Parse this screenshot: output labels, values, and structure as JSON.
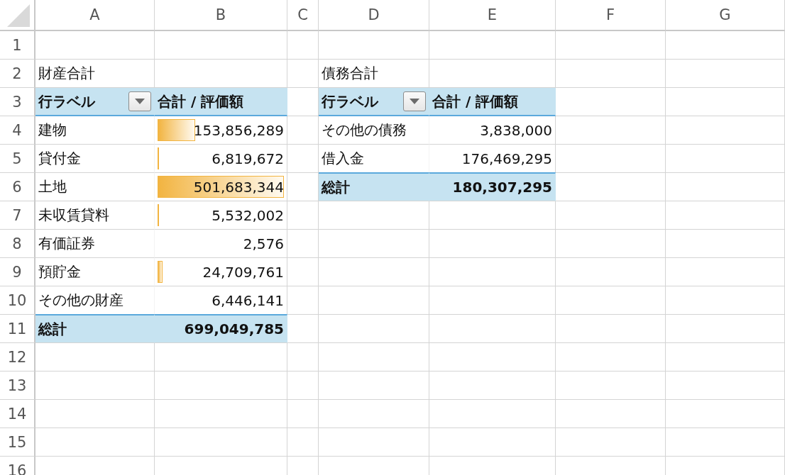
{
  "columns": [
    "A",
    "B",
    "C",
    "D",
    "E",
    "F",
    "G"
  ],
  "rows": [
    {
      "number": "1",
      "cells": [
        {
          "kind": "blank"
        },
        {
          "kind": "blank"
        },
        {
          "kind": "blank"
        },
        {
          "kind": "blank"
        },
        {
          "kind": "blank"
        },
        {
          "kind": "blank"
        },
        {
          "kind": "blank"
        }
      ]
    },
    {
      "number": "2",
      "cells": [
        {
          "kind": "label",
          "text": "財産合計"
        },
        {
          "kind": "blank"
        },
        {
          "kind": "blank"
        },
        {
          "kind": "label",
          "text": "債務合計"
        },
        {
          "kind": "blank"
        },
        {
          "kind": "blank"
        },
        {
          "kind": "blank"
        }
      ]
    },
    {
      "number": "3",
      "cells": [
        {
          "kind": "header-label",
          "text": "行ラベル"
        },
        {
          "kind": "header-value",
          "text": "合計 / 評価額"
        },
        {
          "kind": "blank"
        },
        {
          "kind": "header-label",
          "text": "行ラベル"
        },
        {
          "kind": "header-value",
          "text": "合計 / 評価額"
        },
        {
          "kind": "blank"
        },
        {
          "kind": "blank"
        }
      ]
    },
    {
      "number": "4",
      "cells": [
        {
          "kind": "item",
          "text": "建物"
        },
        {
          "kind": "value",
          "text": "153,856,289",
          "level": 0.3
        },
        {
          "kind": "blank"
        },
        {
          "kind": "item",
          "text": "その他の債務"
        },
        {
          "kind": "value",
          "text": "3,838,000"
        },
        {
          "kind": "blank"
        },
        {
          "kind": "blank"
        }
      ]
    },
    {
      "number": "5",
      "cells": [
        {
          "kind": "item",
          "text": "貸付金"
        },
        {
          "kind": "value",
          "text": "6,819,672",
          "level": 0.006
        },
        {
          "kind": "blank"
        },
        {
          "kind": "item",
          "text": "借入金"
        },
        {
          "kind": "value",
          "text": "176,469,295"
        },
        {
          "kind": "blank"
        },
        {
          "kind": "blank"
        }
      ]
    },
    {
      "number": "6",
      "cells": [
        {
          "kind": "item",
          "text": "土地"
        },
        {
          "kind": "value",
          "text": "501,683,344",
          "level": 1
        },
        {
          "kind": "blank"
        },
        {
          "kind": "total-label",
          "text": "総計"
        },
        {
          "kind": "total-value",
          "text": "180,307,295"
        },
        {
          "kind": "blank"
        },
        {
          "kind": "blank"
        }
      ]
    },
    {
      "number": "7",
      "cells": [
        {
          "kind": "item",
          "text": "未収賃貸料"
        },
        {
          "kind": "value",
          "text": "5,532,002",
          "level": 0.006
        },
        {
          "kind": "blank"
        },
        {
          "kind": "blank"
        },
        {
          "kind": "blank"
        },
        {
          "kind": "blank"
        },
        {
          "kind": "blank"
        }
      ]
    },
    {
      "number": "8",
      "cells": [
        {
          "kind": "item",
          "text": "有価証券"
        },
        {
          "kind": "value",
          "text": "2,576"
        },
        {
          "kind": "blank"
        },
        {
          "kind": "blank"
        },
        {
          "kind": "blank"
        },
        {
          "kind": "blank"
        },
        {
          "kind": "blank"
        }
      ]
    },
    {
      "number": "9",
      "cells": [
        {
          "kind": "item",
          "text": "預貯金"
        },
        {
          "kind": "value",
          "text": "24,709,761",
          "level": 0.04
        },
        {
          "kind": "blank"
        },
        {
          "kind": "blank"
        },
        {
          "kind": "blank"
        },
        {
          "kind": "blank"
        },
        {
          "kind": "blank"
        }
      ]
    },
    {
      "number": "10",
      "cells": [
        {
          "kind": "item",
          "text": "その他の財産"
        },
        {
          "kind": "value",
          "text": "6,446,141"
        },
        {
          "kind": "blank"
        },
        {
          "kind": "blank"
        },
        {
          "kind": "blank"
        },
        {
          "kind": "blank"
        },
        {
          "kind": "blank"
        }
      ]
    },
    {
      "number": "11",
      "cells": [
        {
          "kind": "total-label",
          "text": "総計"
        },
        {
          "kind": "total-value",
          "text": "699,049,785"
        },
        {
          "kind": "blank"
        },
        {
          "kind": "blank"
        },
        {
          "kind": "blank"
        },
        {
          "kind": "blank"
        },
        {
          "kind": "blank"
        }
      ]
    },
    {
      "number": "12",
      "cells": [
        {
          "kind": "blank"
        },
        {
          "kind": "blank"
        },
        {
          "kind": "blank"
        },
        {
          "kind": "blank"
        },
        {
          "kind": "blank"
        },
        {
          "kind": "blank"
        },
        {
          "kind": "blank"
        }
      ]
    },
    {
      "number": "13",
      "cells": [
        {
          "kind": "blank"
        },
        {
          "kind": "blank"
        },
        {
          "kind": "blank"
        },
        {
          "kind": "blank"
        },
        {
          "kind": "blank"
        },
        {
          "kind": "blank"
        },
        {
          "kind": "blank"
        }
      ]
    },
    {
      "number": "14",
      "cells": [
        {
          "kind": "blank"
        },
        {
          "kind": "blank"
        },
        {
          "kind": "blank"
        },
        {
          "kind": "blank"
        },
        {
          "kind": "blank"
        },
        {
          "kind": "blank"
        },
        {
          "kind": "blank"
        }
      ]
    },
    {
      "number": "15",
      "cells": [
        {
          "kind": "blank"
        },
        {
          "kind": "blank"
        },
        {
          "kind": "blank"
        },
        {
          "kind": "blank"
        },
        {
          "kind": "blank"
        },
        {
          "kind": "blank"
        },
        {
          "kind": "blank"
        }
      ]
    },
    {
      "number": "16",
      "cells": [
        {
          "kind": "blank"
        },
        {
          "kind": "blank"
        },
        {
          "kind": "blank"
        },
        {
          "kind": "blank"
        },
        {
          "kind": "blank"
        },
        {
          "kind": "blank"
        },
        {
          "kind": "blank"
        }
      ]
    }
  ]
}
